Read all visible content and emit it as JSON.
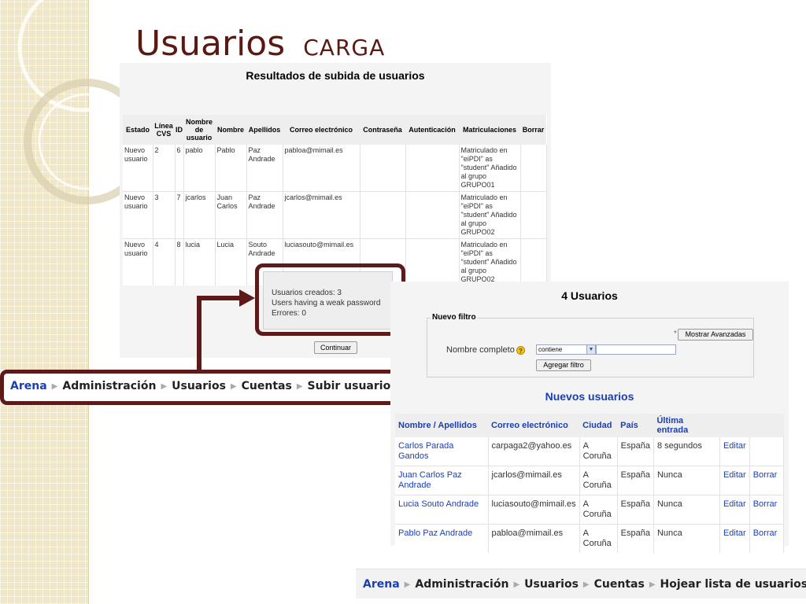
{
  "slide": {
    "title": "Usuarios",
    "subtitle": "CARGA"
  },
  "upload_results": {
    "heading": "Resultados de subida de usuarios",
    "columns": [
      "Estado",
      "Línea CVS",
      "ID",
      "Nombre de usuario",
      "Nombre",
      "Apellidos",
      "Correo electrónico",
      "Contraseña",
      "Autenticación",
      "Matriculaciones",
      "Borrar"
    ],
    "rows": [
      [
        "Nuevo usuario",
        "2",
        "6",
        "pablo",
        "Pablo",
        "Paz Andrade",
        "pabloa@mimail.es",
        "",
        "",
        "Matriculado en \"eiPDI\" as \"student\" Añadido al grupo GRUPO01",
        ""
      ],
      [
        "Nuevo usuario",
        "3",
        "7",
        "jcarlos",
        "Juan Carlos",
        "Paz Andrade",
        "jcarlos@mimail.es",
        "",
        "",
        "Matriculado en \"eiPDI\" as \"student\" Añadido al grupo GRUPO02",
        ""
      ],
      [
        "Nuevo usuario",
        "4",
        "8",
        "lucia",
        "Lucia",
        "Souto Andrade",
        "luciasouto@mimail.es",
        "",
        "",
        "Matriculado en \"eiPDI\" as \"student\" Añadido al grupo GRUPO02",
        ""
      ]
    ],
    "summary": {
      "created": "Usuarios creados: 3",
      "weak": "Users having a weak password",
      "errors": "Errores: 0"
    },
    "continue_button": "Continuar"
  },
  "breadcrumb_upload": {
    "items": [
      "Arena",
      "Administración",
      "Usuarios",
      "Cuentas",
      "Subir usuarios"
    ]
  },
  "user_list": {
    "count_title": "4 Usuarios",
    "filter": {
      "legend": "Nuevo filtro",
      "advanced_button": "Mostrar Avanzadas",
      "field_label": "Nombre completo",
      "operator": "contiene",
      "value": "",
      "add_button": "Agregar filtro"
    },
    "new_users_title": "Nuevos usuarios",
    "columns": [
      "Nombre / Apellidos",
      "Correo electrónico",
      "Ciudad",
      "País",
      "Última entrada",
      "",
      ""
    ],
    "rows": [
      [
        "Carlos Parada Gandos",
        "carpaga2@yahoo.es",
        "A Coruña",
        "España",
        "8 segundos",
        "Editar",
        ""
      ],
      [
        "Juan Carlos Paz Andrade",
        "jcarlos@mimail.es",
        "A Coruña",
        "España",
        "Nunca",
        "Editar",
        "Borrar"
      ],
      [
        "Lucia Souto Andrade",
        "luciasouto@mimail.es",
        "A Coruña",
        "España",
        "Nunca",
        "Editar",
        "Borrar"
      ],
      [
        "Pablo Paz Andrade",
        "pabloa@mimail.es",
        "A Coruña",
        "España",
        "Nunca",
        "Editar",
        "Borrar"
      ]
    ]
  },
  "breadcrumb_list": {
    "items": [
      "Arena",
      "Administración",
      "Usuarios",
      "Cuentas",
      "Hojear lista de usuarios"
    ]
  },
  "colors": {
    "accent_dark_red": "#5c1a1a",
    "link_blue": "#1b3fb0",
    "title_brown": "#5a1a12"
  }
}
